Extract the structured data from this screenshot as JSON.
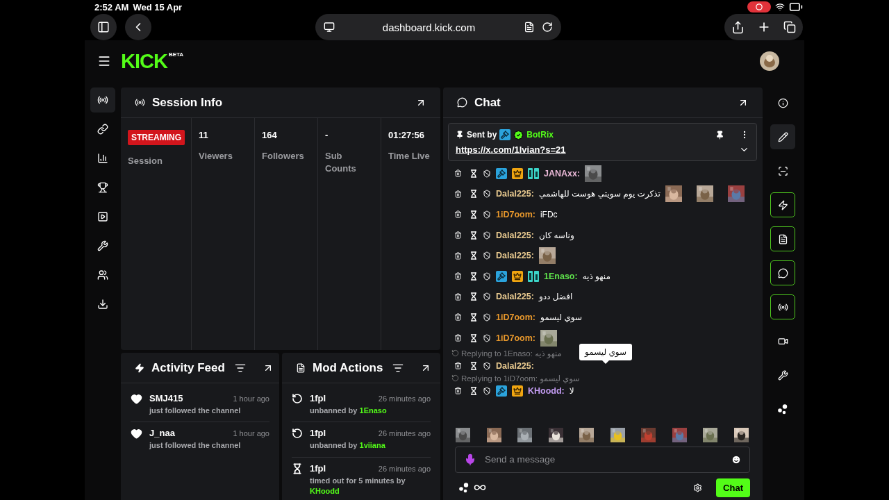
{
  "status_bar": {
    "time": "2:52 AM",
    "date": "Wed 15 Apr"
  },
  "browser": {
    "url": "dashboard.kick.com"
  },
  "header": {
    "logo": "KICK",
    "logo_badge": "BETA"
  },
  "left_sidebar": [
    {
      "selected": true
    },
    {
      "selected": false
    },
    {
      "selected": false
    },
    {
      "selected": false
    },
    {
      "selected": false
    },
    {
      "selected": false
    },
    {
      "selected": false
    },
    {
      "selected": false
    }
  ],
  "right_sidebar": [
    {
      "selected": false,
      "active": false
    },
    {
      "selected": true,
      "active": false
    },
    {
      "selected": false,
      "active": false
    },
    {
      "selected": false,
      "active": true
    },
    {
      "selected": false,
      "active": true
    },
    {
      "selected": false,
      "active": true
    },
    {
      "selected": false,
      "active": true
    },
    {
      "selected": false,
      "active": false
    },
    {
      "selected": false,
      "active": false
    },
    {
      "selected": false,
      "active": false
    }
  ],
  "session_info": {
    "title": "Session Info",
    "status": "STREAMING",
    "status_label": "Session",
    "stats": [
      {
        "value": "11",
        "label": "Viewers"
      },
      {
        "value": "164",
        "label": "Followers"
      },
      {
        "value": "-",
        "label": "Sub Counts"
      },
      {
        "value": "01:27:56",
        "label": "Time Live"
      }
    ]
  },
  "chat": {
    "title": "Chat",
    "pinned": {
      "prefix": "Sent by",
      "user": "BotRix",
      "link": "https://x.com/1lvian?s=21"
    },
    "messages": [
      {
        "user": "JANAxx:",
        "color": "#e9b7d6",
        "badges": [
          {
            "kind": "mod"
          },
          {
            "kind": "sub"
          },
          {
            "kind": "og"
          }
        ],
        "emotes": [
          {
            "kind": "picture"
          }
        ]
      },
      {
        "user": "Dalal225:",
        "color": "#e8c98f",
        "text": "تذكرت يوم سويتي هوست للهاشمي",
        "emotes": [
          {
            "kind": "picture"
          },
          {
            "kind": "picture"
          },
          {
            "kind": "picture"
          }
        ]
      },
      {
        "user": "1iD7oom:",
        "color": "#e8982c",
        "text": "iFDc"
      },
      {
        "user": "Dalal225:",
        "color": "#e8c98f",
        "text": "وناسه كان"
      },
      {
        "user": "Dalal225:",
        "color": "#e8c98f",
        "emotes": [
          {
            "kind": "picture"
          }
        ]
      },
      {
        "user": "1Enaso:",
        "color": "#5fe34c",
        "badges": [
          {
            "kind": "mod"
          },
          {
            "kind": "sub"
          },
          {
            "kind": "og"
          }
        ],
        "text": "منهو ذيه"
      },
      {
        "user": "Dalal225:",
        "color": "#e8c98f",
        "text": "افضل ددو"
      },
      {
        "user": "1iD7oom:",
        "color": "#e8982c",
        "text": "سوي ليسمو"
      },
      {
        "user": "1iD7oom:",
        "color": "#e8982c",
        "emotes": [
          {
            "kind": "picture"
          }
        ]
      },
      {
        "user": "Dalal225:",
        "color": "#e8c98f",
        "reply": {
          "label": "Replying to 1Enaso:",
          "text": "منهو ذيه"
        },
        "tooltip": "سوي ليسمو"
      },
      {
        "user": "KHoodd:",
        "color": "#c39cf2",
        "badges": [
          {
            "kind": "mod"
          },
          {
            "kind": "sub"
          }
        ],
        "text": "لا",
        "reply": {
          "label": "Replying to 1iD7oom:",
          "text": "سوي ليسمو"
        }
      }
    ],
    "emote_bar": [
      {
        "kind": "picture"
      },
      {
        "kind": "picture"
      },
      {
        "kind": "picture"
      },
      {
        "kind": "picture"
      },
      {
        "kind": "picture"
      },
      {
        "kind": "picture"
      },
      {
        "kind": "picture"
      },
      {
        "kind": "picture"
      },
      {
        "kind": "picture"
      },
      {
        "kind": "picture"
      }
    ],
    "input": {
      "placeholder": "Send a message"
    },
    "send_button": "Chat"
  },
  "activity_feed": {
    "title": "Activity Feed",
    "items": [
      {
        "user": "SMJ415",
        "time": "1 hour ago",
        "text": "just followed the channel"
      },
      {
        "user": "J_naa",
        "time": "1 hour ago",
        "text": "just followed the channel"
      }
    ]
  },
  "mod_actions": {
    "title": "Mod Actions",
    "items": [
      {
        "kind": "unban",
        "user": "1fpl",
        "time": "26 minutes ago",
        "action": "unbanned by",
        "by": "1Enaso"
      },
      {
        "kind": "unban",
        "user": "1fpl",
        "time": "26 minutes ago",
        "action": "unbanned by",
        "by": "1viiana"
      },
      {
        "kind": "timeout",
        "user": "1fpl",
        "time": "26 minutes ago",
        "action": "timed out for 5 minutes by",
        "by": "KHoodd"
      }
    ]
  }
}
